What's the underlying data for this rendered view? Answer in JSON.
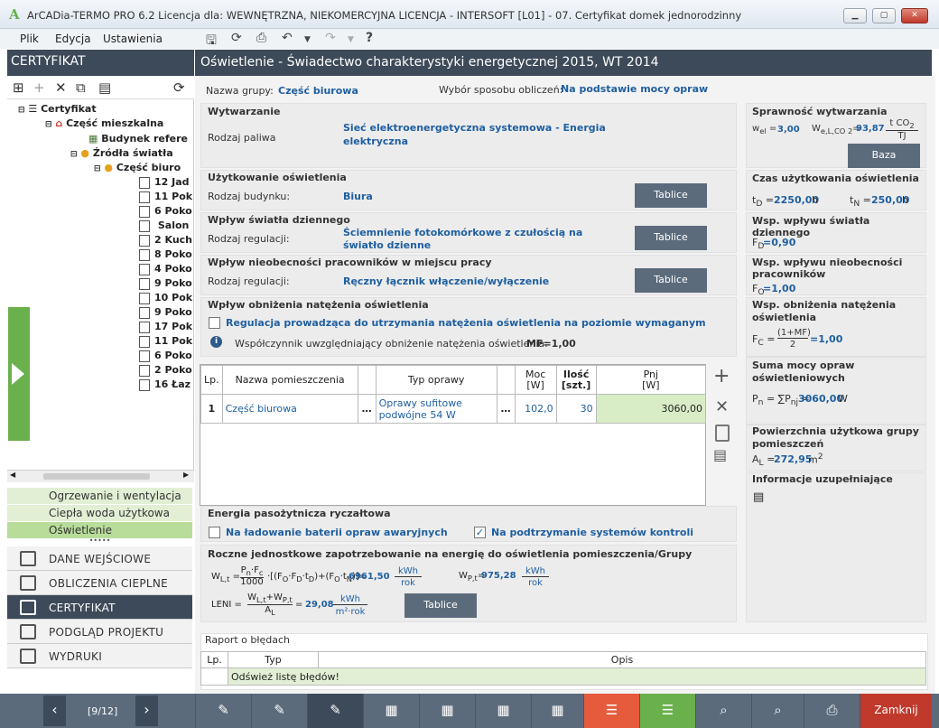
{
  "window": {
    "title": "ArCADia-TERMO PRO 6.2 Licencja dla: WEWNĘTRZNA, NIEKOMERCYJNA LICENCJA - INTERSOFT [L01] - 07. Certyfikat domek jednorodzinny"
  },
  "menu": {
    "plik": "Plik",
    "edycja": "Edycja",
    "ustawienia": "Ustawienia"
  },
  "left": {
    "header": "CERTYFIKAT",
    "tree": [
      "Certyfikat",
      "Część mieszkalna",
      "Budynek refere",
      "Źródła światła",
      "Część biuro",
      "12 Jad",
      "11 Pok",
      "6 Poko",
      "Salon",
      "2 Kuch",
      "8 Poko",
      "4 Poko",
      "9 Poko",
      "10 Pok",
      "9 Poko",
      "17 Pok",
      "11 Pok",
      "6 Poko",
      "2 Poko",
      "16 Łaz"
    ],
    "subnav": [
      "Ogrzewanie i wentylacja",
      "Ciepła woda użytkowa",
      "Oświetlenie"
    ],
    "nav": [
      "DANE WEJŚCIOWE",
      "OBLICZENIA CIEPLNE",
      "CERTYFIKAT",
      "PODGLĄD PROJEKTU",
      "WYDRUKI"
    ],
    "page": "[9/12]"
  },
  "main": {
    "header": "Oświetlenie - Świadectwo charakterystyki energetycznej 2015, WT 2014",
    "group_label": "Nazwa grupy:",
    "group_value": "Część biurowa",
    "method_label": "Wybór sposobu obliczeń:",
    "method_value": "Na podstawie mocy opraw",
    "wytw_title": "Wytwarzanie",
    "fuel_label": "Rodzaj paliwa",
    "fuel_value": "Sieć elektroenergetyczna systemowa - Energia elektryczna",
    "uzyt_title": "Użytkowanie oświetlenia",
    "bud_label": "Rodzaj budynku:",
    "bud_value": "Biura",
    "dz_title": "Wpływ światła dziennego",
    "reg_label": "Rodzaj regulacji:",
    "dz_value": "Ściemnienie fotokomórkowe z czułością na światło dzienne",
    "nieob_title": "Wpływ nieobecności pracowników w miejscu pracy",
    "nieob_value": "Ręczny łącznik włączenie/wyłączenie",
    "obn_title": "Wpływ obniżenia natężenia oświetlenia",
    "obn_check": "Regulacja prowadząca do utrzymania natężenia oświetlenia na poziomie wymaganym",
    "mf_label": "Współczynnik uwzględniający obniżenie natężenia oświetlenia:",
    "mf_value": "MF=1,00",
    "tablice": "Tablice",
    "table": {
      "headers": [
        "Lp.",
        "Nazwa pomieszczenia",
        "Typ oprawy",
        "Moc\n[W]",
        "Ilość\n[szt.]",
        "Pnj\n[W]"
      ],
      "rows": [
        [
          "1",
          "Część biurowa",
          "Oprawy sufitowe podwójne 54 W",
          "102,0",
          "30",
          "3060,00"
        ]
      ]
    },
    "en_title": "Energia pasożytnicza ryczałtowa",
    "en_c1": "Na ładowanie baterii opraw awaryjnych",
    "en_c2": "Na podtrzymanie systemów kontroli",
    "roc_title": "Roczne jednostkowe zapotrzebowanie na energię do oświetlenia pomieszczenia/Grupy",
    "wlt": "6961,50",
    "wpt": "975,28",
    "leni": "29,08",
    "err_title": "Raport o błędach",
    "err_headers": [
      "Lp.",
      "Typ",
      "Opis"
    ],
    "err_row": "Odśwież listę błędów!"
  },
  "right": {
    "spr_title": "Sprawność wytwarzania",
    "wel": "3,00",
    "wco2": "93,87",
    "baza": "Baza",
    "czas_title": "Czas użytkowania oświetlenia",
    "td": "2250,00",
    "tn": "250,00",
    "fd_title": "Wsp. wpływu światła dziennego",
    "fd": "F",
    "fdv": "=0,90",
    "fo_title": "Wsp. wpływu nieobecności pracowników",
    "fov": "=1,00",
    "fc_title": "Wsp. obniżenia natężenia oświetlenia",
    "fcv": "=1,00",
    "pn_title": "Suma mocy opraw oświetleniowych",
    "pn": "3060,00",
    "al_title": "Powierzchnia użytkowa grupy pomieszczeń",
    "al": "272,95",
    "info_title": "Informacje uzupełniające"
  },
  "footer": {
    "close": "Zamknij"
  },
  "colors": {
    "dark": "#3c4a59",
    "green": "#6ab04c",
    "red": "#c0392b",
    "button": "#5b6b7c",
    "value": "#1f5fa0"
  }
}
